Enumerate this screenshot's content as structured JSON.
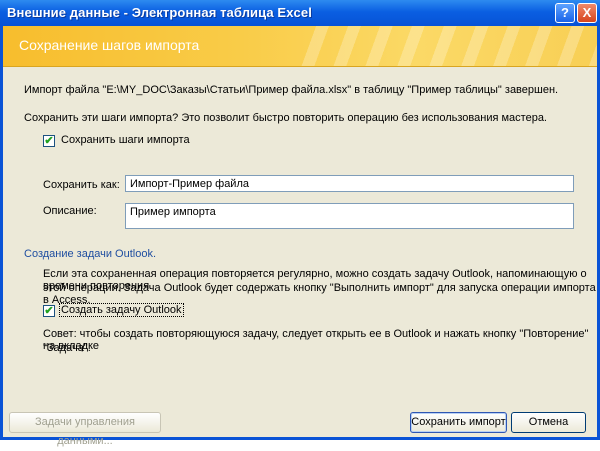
{
  "window": {
    "title": "Внешние данные - Электронная таблица Excel",
    "help_label": "?",
    "close_label": "X"
  },
  "banner": {
    "title": "Сохранение шагов импорта"
  },
  "status_text": "Импорт файла \"E:\\MY_DOC\\Заказы\\Статьи\\Пример файла.xlsx\" в таблицу \"Пример таблицы\" завершен.",
  "save_question": "Сохранить эти шаги импорта? Это позволит быстро повторить операцию без использования мастера.",
  "save_steps_checkbox": {
    "label": "Сохранить шаги импорта",
    "checked": "✔"
  },
  "save_as": {
    "label": "Сохранить как:",
    "value": "Импорт-Пример файла"
  },
  "description": {
    "label": "Описание:",
    "value": "Пример импорта"
  },
  "outlook": {
    "heading": "Создание задачи Outlook.",
    "info_line1": "Если эта сохраненная операция повторяется регулярно, можно создать задачу Outlook, напоминающую о времени повторения",
    "info_line2": "этой операции. Задача Outlook будет содержать кнопку \"Выполнить импорт\" для запуска операции импорта в Access.",
    "checkbox_label": "Создать задачу Outlook",
    "checked": "✔",
    "tip_line1": "Совет: чтобы создать повторяющуюся задачу, следует открыть ее в Outlook и нажать кнопку \"Повторение\" на вкладке",
    "tip_line2": "\"Задача\"."
  },
  "buttons": {
    "manage_tasks": "Задачи управления данными...",
    "save_import": "Сохранить импорт",
    "cancel": "Отмена"
  }
}
